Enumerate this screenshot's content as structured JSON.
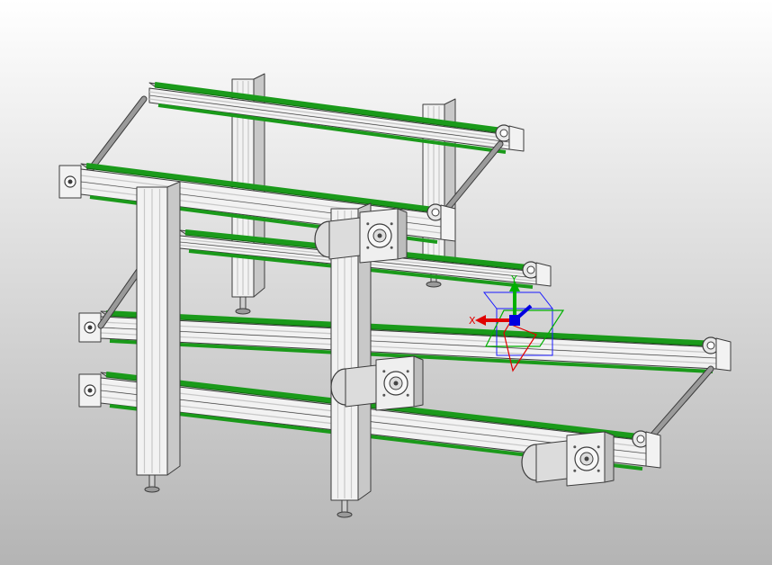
{
  "viewport": {
    "background_top": "#ffffff",
    "background_bottom": "#b4b4b4"
  },
  "colors": {
    "profile_face": "#f2f2f2",
    "profile_edge": "#3c3c3c",
    "profile_groove": "#c8c8c8",
    "belt": "#1a9a1a",
    "belt_dark": "#0e6a0e",
    "shaft": "#9a9a9a",
    "motor": "#dcdcdc",
    "triad_x": "#e00000",
    "triad_y": "#00b000",
    "triad_z": "#0000e0",
    "triad_box": "#1a1aff"
  },
  "triad": {
    "x_label": "X",
    "y_label": "Y"
  },
  "model": {
    "conveyors": [
      {
        "name": "upper-rear-conveyor",
        "icon": "belt-conveyor"
      },
      {
        "name": "upper-front-conveyor",
        "icon": "belt-conveyor"
      },
      {
        "name": "middle-conveyor",
        "icon": "belt-conveyor"
      },
      {
        "name": "extended-conveyor",
        "icon": "belt-conveyor"
      },
      {
        "name": "lower-conveyor",
        "icon": "belt-conveyor"
      }
    ],
    "motors": [
      "gear-motor",
      "gear-motor",
      "gear-motor"
    ],
    "legs": [
      "aluminium-profile-leg",
      "aluminium-profile-leg",
      "aluminium-profile-leg",
      "aluminium-profile-leg"
    ]
  }
}
